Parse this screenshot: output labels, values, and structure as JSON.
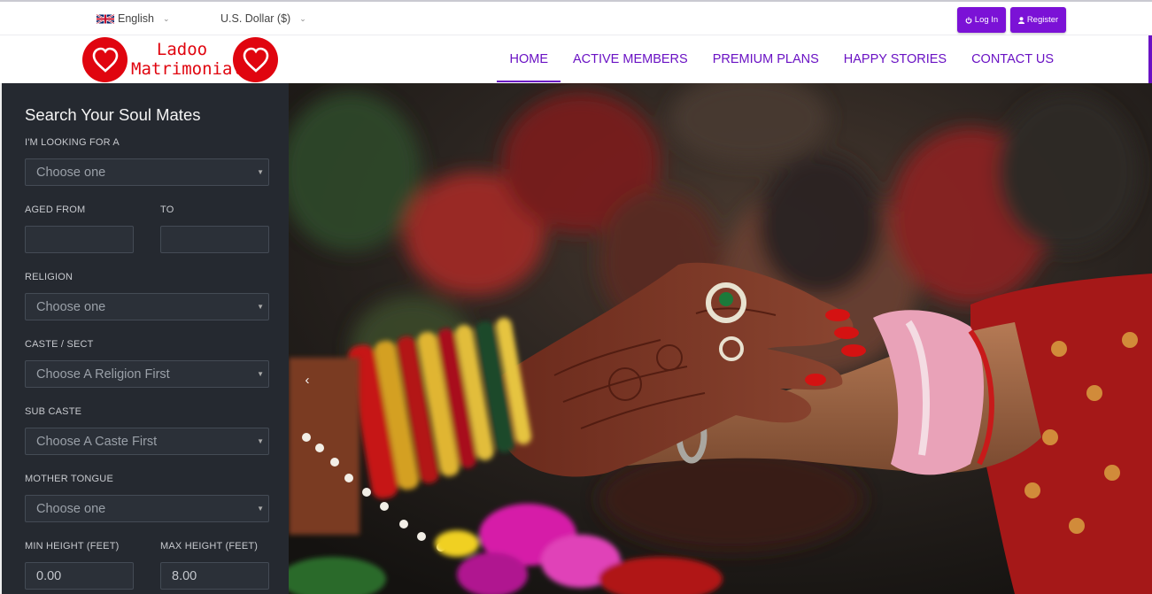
{
  "topbar": {
    "language": "English",
    "currency": "U.S. Dollar ($)",
    "login_label": "Log In",
    "register_label": "Register"
  },
  "logo": {
    "line1": "Ladoo",
    "line2": "Matrimonial"
  },
  "nav": {
    "items": [
      {
        "label": "HOME",
        "active": true
      },
      {
        "label": "ACTIVE MEMBERS",
        "active": false
      },
      {
        "label": "PREMIUM PLANS",
        "active": false
      },
      {
        "label": "HAPPY STORIES",
        "active": false
      },
      {
        "label": "CONTACT US",
        "active": false
      }
    ]
  },
  "search": {
    "title": "Search Your Soul Mates",
    "looking_for": {
      "label": "I'M LOOKING FOR A",
      "value": "Choose one"
    },
    "aged_from": {
      "label": "AGED FROM",
      "value": ""
    },
    "aged_to": {
      "label": "TO",
      "value": ""
    },
    "religion": {
      "label": "RELIGION",
      "value": "Choose one"
    },
    "caste": {
      "label": "CASTE / SECT",
      "value": "Choose A Religion First"
    },
    "sub_caste": {
      "label": "SUB CASTE",
      "value": "Choose A Caste First"
    },
    "mother_tongue": {
      "label": "MOTHER TONGUE",
      "value": "Choose one"
    },
    "min_height": {
      "label": "MIN HEIGHT (FEET)",
      "value": "0.00"
    },
    "max_height": {
      "label": "MAX HEIGHT (FEET)",
      "value": "8.00"
    }
  },
  "hero": {
    "prev_icon": "chevron-left-icon"
  },
  "colors": {
    "accent": "#6a12c4",
    "button": "#7b12d6",
    "logo_red": "#e0050f",
    "sidebar_bg": "#252930"
  }
}
